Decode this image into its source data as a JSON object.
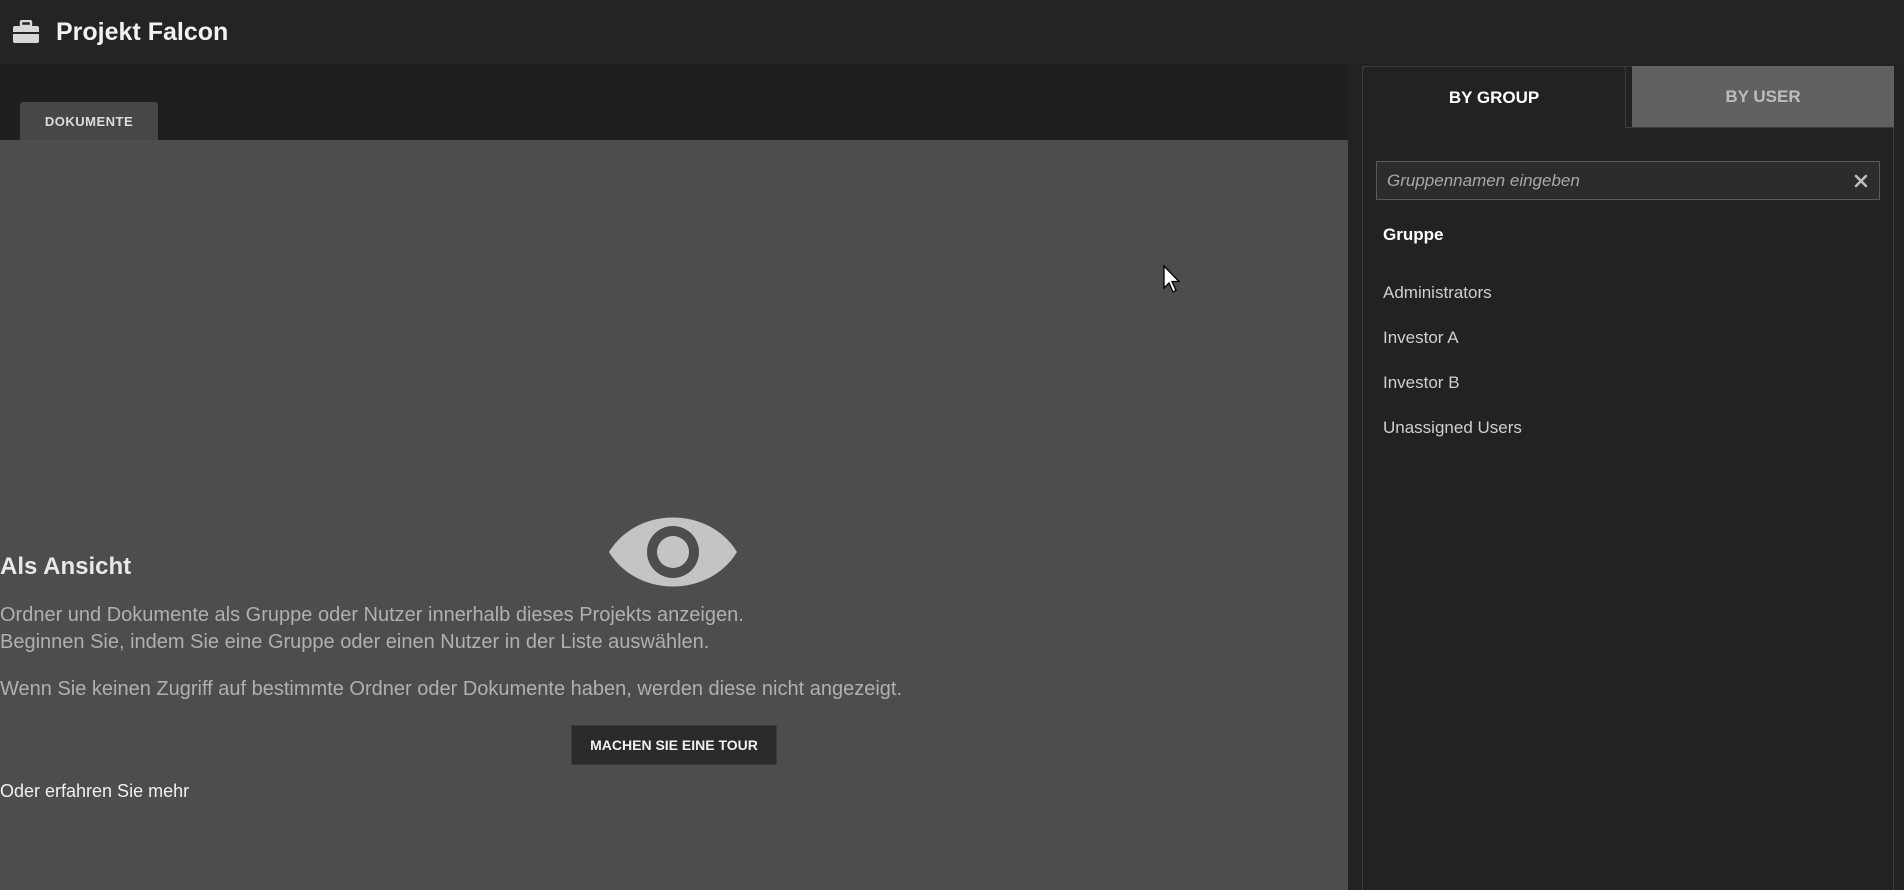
{
  "header": {
    "title": "Projekt Falcon",
    "icon": "briefcase-icon"
  },
  "tabs": [
    {
      "label": "DOKUMENTE"
    }
  ],
  "empty_state": {
    "icon": "eye-icon",
    "heading": "Als Ansicht",
    "line1": "Ordner und Dokumente als Gruppe oder Nutzer innerhalb dieses Projekts anzeigen.",
    "line2": "Beginnen Sie, indem Sie eine Gruppe oder einen Nutzer in der Liste auswählen.",
    "line3": "Wenn Sie keinen Zugriff auf bestimmte Ordner oder Dokumente haben, werden diese nicht angezeigt.",
    "tour_button": "MACHEN SIE EINE TOUR",
    "learn_more": "Oder erfahren Sie mehr"
  },
  "panel": {
    "tabs": [
      {
        "label": "BY GROUP",
        "active": true
      },
      {
        "label": "BY USER",
        "active": false
      }
    ],
    "search": {
      "placeholder": "Gruppennamen eingeben",
      "value": ""
    },
    "column_header": "Gruppe",
    "groups": [
      {
        "label": "Administrators"
      },
      {
        "label": "Investor A"
      },
      {
        "label": "Investor B"
      },
      {
        "label": "Unassigned Users"
      }
    ]
  },
  "colors": {
    "background": "#222222",
    "content": "#4d4d4d",
    "inactive_tab": "#616161"
  }
}
